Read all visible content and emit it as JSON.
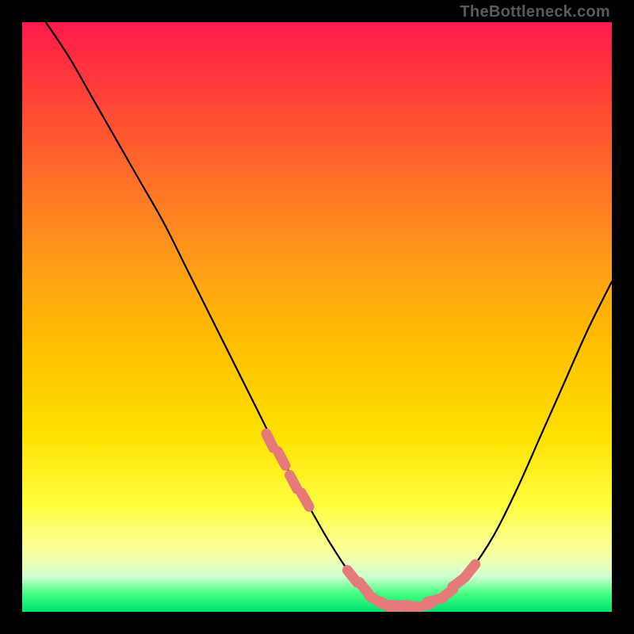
{
  "watermark": "TheBottleneck.com",
  "colors": {
    "background": "#000000",
    "curve": "#000000",
    "marker_fill": "#e67a7a",
    "marker_stroke": "#cc5c5c",
    "gradient_top": "#ff1a4d",
    "gradient_bottom": "#00e070"
  },
  "chart_data": {
    "type": "line",
    "title": "",
    "xlabel": "",
    "ylabel": "",
    "xlim": [
      0,
      100
    ],
    "ylim": [
      0,
      100
    ],
    "grid": false,
    "legend": false,
    "series": [
      {
        "name": "bottleneck-curve",
        "x": [
          4,
          8,
          12,
          16,
          20,
          24,
          28,
          32,
          36,
          40,
          44,
          48,
          52,
          56,
          60,
          64,
          68,
          72,
          76,
          80,
          84,
          88,
          92,
          96,
          100
        ],
        "values": [
          100,
          94,
          87,
          80,
          73,
          66,
          58,
          50,
          42,
          34,
          26,
          19,
          12,
          6,
          2,
          1,
          1,
          3,
          7,
          13,
          21,
          30,
          39,
          48,
          56
        ]
      }
    ],
    "markers": {
      "name": "highlighted-points",
      "x": [
        42,
        44,
        46,
        48,
        56,
        58,
        60,
        62,
        64,
        66,
        68,
        70,
        72,
        74,
        76
      ],
      "values": [
        29,
        26,
        22,
        19,
        6,
        4,
        2,
        1,
        1,
        1,
        1,
        2,
        3,
        5,
        7
      ]
    },
    "note": "Values are read off axis-free gradient plot: 0 = bottom (green), 100 = top (red). x spans full width 0-100."
  }
}
